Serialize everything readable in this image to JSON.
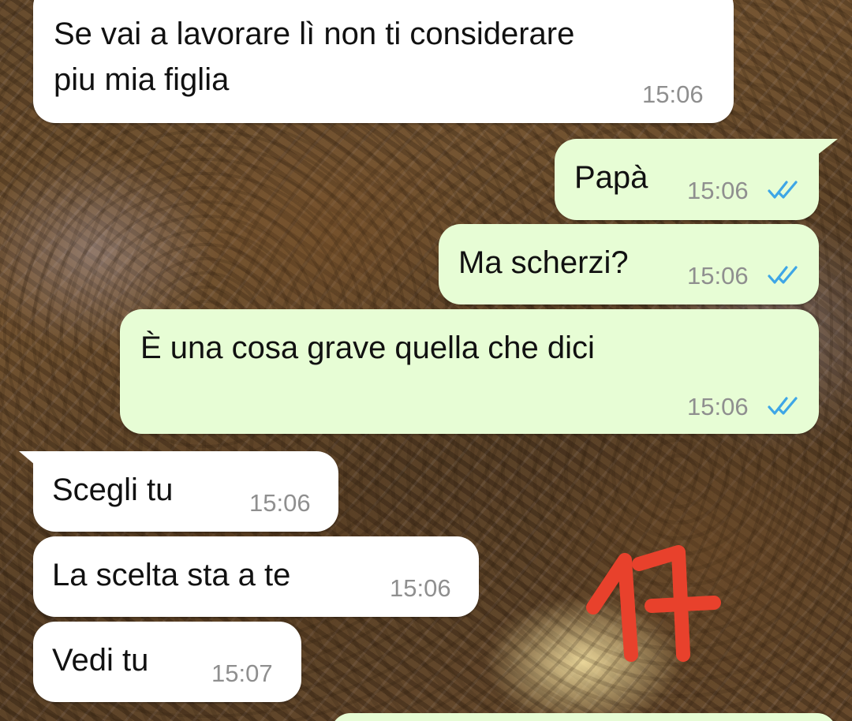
{
  "messages": [
    {
      "direction": "incoming",
      "text_line1": "Se vai a lavorare lì non ti considerare",
      "text_line2": "piu mia figlia",
      "time": "15:06"
    },
    {
      "direction": "outgoing",
      "text": "Papà",
      "time": "15:06",
      "read": true
    },
    {
      "direction": "outgoing",
      "text": "Ma scherzi?",
      "time": "15:06",
      "read": true
    },
    {
      "direction": "outgoing",
      "text": "È una cosa grave quella che dici",
      "time": "15:06",
      "read": true
    },
    {
      "direction": "incoming",
      "text": "Scegli tu",
      "time": "15:06"
    },
    {
      "direction": "incoming",
      "text": "La scelta sta a te",
      "time": "15:06"
    },
    {
      "direction": "incoming",
      "text": "Vedi tu",
      "time": "15:07"
    }
  ],
  "annotation": {
    "text": "17",
    "color": "#e8412c"
  },
  "colors": {
    "incoming_bubble": "#ffffff",
    "outgoing_bubble": "#e7fdd5",
    "read_ticks": "#3ea6e6",
    "time_text": "#8f8f8f"
  },
  "icons": {
    "read_receipt": "double-check-icon"
  }
}
